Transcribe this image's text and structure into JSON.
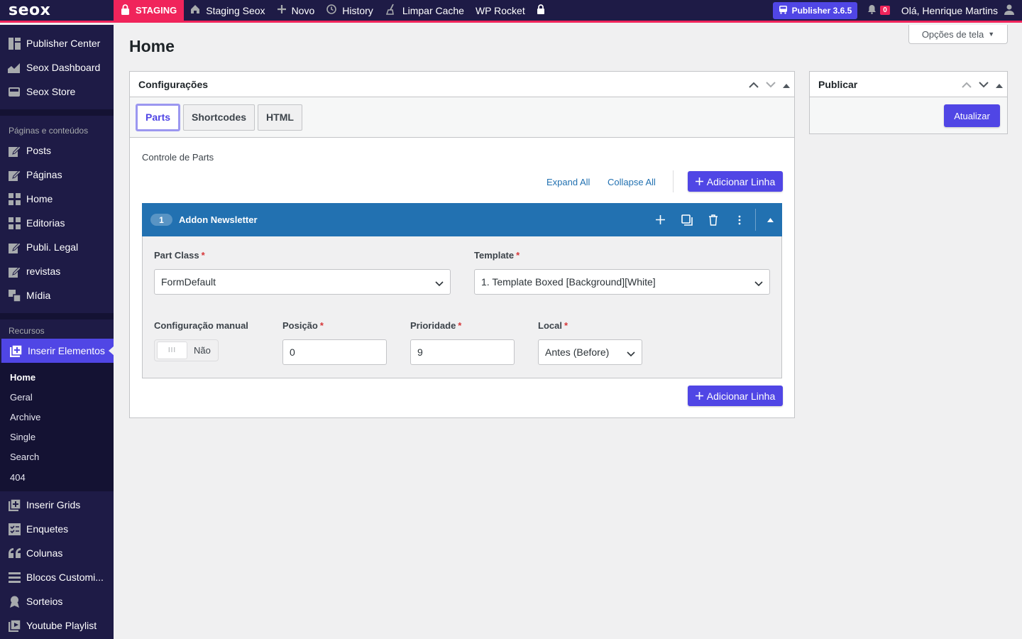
{
  "adminbar": {
    "logo": "seox",
    "staging": "STAGING",
    "items": [
      {
        "label": "Staging Seox",
        "icon": "home-icon"
      },
      {
        "label": "Novo",
        "icon": "plus-icon"
      },
      {
        "label": "History",
        "icon": "history-icon"
      },
      {
        "label": "Limpar Cache",
        "icon": "broom-icon"
      },
      {
        "label": "WP Rocket",
        "icon": ""
      }
    ],
    "publisher_badge": "Publisher 3.6.5",
    "notification_count": "0",
    "howdy": "Olá, Henrique Martins"
  },
  "sidebar": {
    "top_items": [
      {
        "label": "Publisher Center",
        "icon": "dashboard-icon"
      },
      {
        "label": "Seox Dashboard",
        "icon": "chart-icon"
      },
      {
        "label": "Seox Store",
        "icon": "store-icon"
      }
    ],
    "section1_heading": "Páginas e conteúdos",
    "section1_items": [
      {
        "label": "Posts",
        "icon": "edit-icon"
      },
      {
        "label": "Páginas",
        "icon": "edit-icon"
      },
      {
        "label": "Home",
        "icon": "grid-icon"
      },
      {
        "label": "Editorias",
        "icon": "grid-icon"
      },
      {
        "label": "Publi. Legal",
        "icon": "edit-icon"
      },
      {
        "label": "revistas",
        "icon": "edit-icon"
      },
      {
        "label": "Mídia",
        "icon": "media-icon"
      }
    ],
    "section2_heading": "Recursos",
    "active_item": "Inserir Elementos",
    "submenu": [
      "Home",
      "Geral",
      "Archive",
      "Single",
      "Search",
      "404"
    ],
    "bottom_items": [
      {
        "label": "Inserir Grids",
        "icon": "plus-square-icon"
      },
      {
        "label": "Enquetes",
        "icon": "poll-icon"
      },
      {
        "label": "Colunas",
        "icon": "quote-icon"
      },
      {
        "label": "Blocos Customi...",
        "icon": "blocks-icon"
      },
      {
        "label": "Sorteios",
        "icon": "award-icon"
      },
      {
        "label": "Youtube Playlist",
        "icon": "playlist-icon"
      }
    ]
  },
  "screen_options": "Opções de tela",
  "page_title": "Home",
  "config_box": {
    "title": "Configurações",
    "tabs": [
      "Parts",
      "Shortcodes",
      "HTML"
    ],
    "section_label": "Controle de Parts",
    "expand_all": "Expand All",
    "collapse_all": "Collapse All",
    "add_row": "Adicionar Linha",
    "part": {
      "number": "1",
      "title": "Addon Newsletter",
      "part_class_label": "Part Class",
      "part_class_value": "FormDefault",
      "template_label": "Template",
      "template_value": "1. Template Boxed [Background][White]",
      "manual_config_label": "Configuração manual",
      "manual_config_value": "Não",
      "position_label": "Posição",
      "position_value": "0",
      "priority_label": "Prioridade",
      "priority_value": "9",
      "local_label": "Local",
      "local_value": "Antes (Before)"
    }
  },
  "publish_box": {
    "title": "Publicar",
    "update_button": "Atualizar"
  },
  "colors": {
    "adminbar": "#1e1b46",
    "accent": "#5046e5",
    "staging": "#f0245b",
    "part_header": "#2271b1"
  }
}
